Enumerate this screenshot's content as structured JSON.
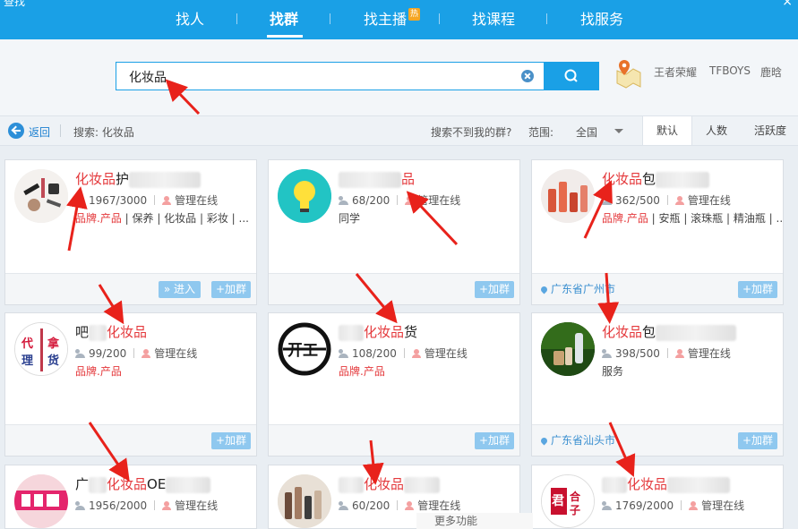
{
  "window": {
    "title": "查找",
    "close": "×"
  },
  "nav": {
    "items": [
      {
        "label": "找人"
      },
      {
        "label": "找群"
      },
      {
        "label": "找主播",
        "badge": "热"
      },
      {
        "label": "找课程"
      },
      {
        "label": "找服务"
      }
    ],
    "active_index": 1
  },
  "search": {
    "value": "化妆品",
    "placeholder": ""
  },
  "hot_words": [
    "王者荣耀",
    "TFBOYS",
    "鹿晗"
  ],
  "filter": {
    "back": "返回",
    "query_label": "搜索: 化妆品",
    "cannot_find": "搜索不到我的群?",
    "scope_label": "范围:",
    "scope_value": "全国",
    "sort_tabs": [
      "默认",
      "人数",
      "活跃度"
    ],
    "active_sort": "默认"
  },
  "cards": [
    {
      "title_hl": "化妆品",
      "title_pre": "",
      "title_post": "护",
      "members": "1967/3000",
      "admin": "管理在线",
      "tags_hl": "品牌.产品",
      "tags_rest": "| 保养 | 化妆品 | 彩妆 | ...",
      "location": "",
      "enter": "» 进入",
      "join": "+加群"
    },
    {
      "title_hl": "品",
      "title_pre": "",
      "title_post": "",
      "members": "68/200",
      "admin": "管理在线",
      "tags_hl": "",
      "tags_rest": "同学",
      "location": "",
      "enter": "",
      "join": "+加群"
    },
    {
      "title_hl": "化妆品",
      "title_pre": "",
      "title_post": "包",
      "members": "362/500",
      "admin": "管理在线",
      "tags_hl": "品牌.产品",
      "tags_rest": "| 安瓶 | 滚珠瓶 | 精油瓶 | ...",
      "location": "广东省广州市",
      "enter": "",
      "join": "+加群"
    },
    {
      "title_hl": "化妆品",
      "title_pre": "吧",
      "title_post": "",
      "members": "99/200",
      "admin": "管理在线",
      "tags_hl": "品牌.产品",
      "tags_rest": "",
      "location": "",
      "enter": "",
      "join": "+加群"
    },
    {
      "title_hl": "化妆品",
      "title_pre": "",
      "title_post": "货",
      "members": "108/200",
      "admin": "管理在线",
      "tags_hl": "品牌.产品",
      "tags_rest": "",
      "location": "",
      "enter": "",
      "join": "+加群"
    },
    {
      "title_hl": "化妆品",
      "title_pre": "",
      "title_post": "包",
      "members": "398/500",
      "admin": "管理在线",
      "tags_hl": "",
      "tags_rest": "服务",
      "location": "广东省汕头市",
      "enter": "",
      "join": "+加群"
    },
    {
      "title_hl": "化妆品",
      "title_pre": "广",
      "title_post": "OE",
      "members": "1956/2000",
      "admin": "管理在线",
      "tags_hl": "",
      "tags_rest": "",
      "location": "",
      "enter": "",
      "join": ""
    },
    {
      "title_hl": "化妆品",
      "title_pre": "",
      "title_post": "",
      "members": "60/200",
      "admin": "管理在线",
      "tags_hl": "",
      "tags_rest": "",
      "location": "",
      "enter": "",
      "join": ""
    },
    {
      "title_hl": "化妆品",
      "title_pre": "",
      "title_post": "",
      "members": "1769/2000",
      "admin": "管理在线",
      "tags_hl": "",
      "tags_rest": "",
      "location": "",
      "enter": "",
      "join": ""
    }
  ],
  "avatar_texts": {
    "card4": [
      "代",
      "拿",
      "理",
      "货"
    ],
    "card5": "开工",
    "card9": [
      "君",
      "合",
      "子"
    ]
  },
  "bottom_panel": "更多功能",
  "colors": {
    "accent": "#1aa0e6",
    "highlight": "#e4393c",
    "arrow": "#e8221b"
  }
}
